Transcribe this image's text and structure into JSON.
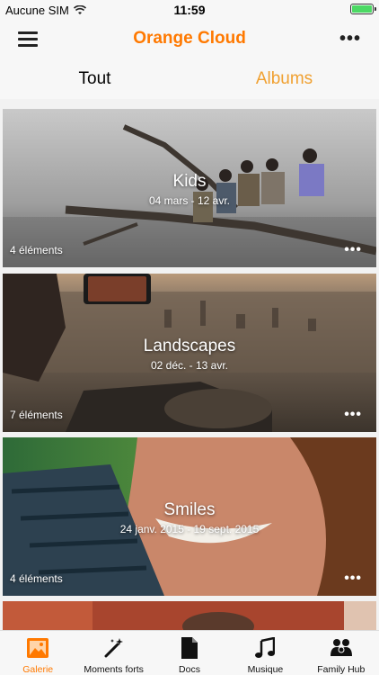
{
  "status": {
    "carrier": "Aucune SIM",
    "time": "11:59"
  },
  "header": {
    "title": "Orange Cloud"
  },
  "tabs": [
    {
      "label": "Tout"
    },
    {
      "label": "Albums"
    }
  ],
  "albums": [
    {
      "title": "Kids",
      "dates": "04 mars - 12 avr.",
      "count": "4 éléments"
    },
    {
      "title": "Landscapes",
      "dates": "02 déc. - 13 avr.",
      "count": "7 éléments"
    },
    {
      "title": "Smiles",
      "dates": "24 janv. 2015 - 19 sept. 2015",
      "count": "4 éléments"
    }
  ],
  "tabbar": [
    {
      "label": "Galerie",
      "icon": "gallery-icon",
      "selected": true
    },
    {
      "label": "Moments forts",
      "icon": "magic-wand-icon"
    },
    {
      "label": "Docs",
      "icon": "document-icon"
    },
    {
      "label": "Musique",
      "icon": "music-note-icon"
    },
    {
      "label": "Family Hub",
      "icon": "family-icon"
    }
  ],
  "colors": {
    "accent": "#ff7900",
    "tab_selected": "#f0a030"
  }
}
